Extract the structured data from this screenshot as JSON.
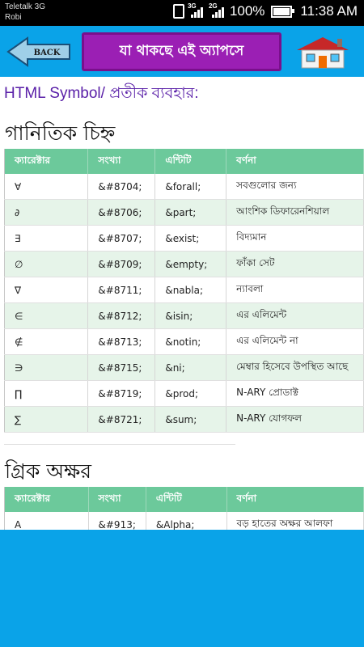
{
  "status_bar": {
    "carrier_line1": "Teletalk 3G",
    "carrier_line2": "Robi",
    "net1": "3G",
    "net2": "2G",
    "battery": "100%",
    "time": "11:38 AM"
  },
  "top_bar": {
    "back_label": "BACK",
    "title": "যা থাকছে এই অ্যাপসে",
    "colors": {
      "bar": "#0aa3e8",
      "title_bg": "#9b1fb4"
    }
  },
  "content": {
    "intro": "HTML Symbol/ প্রতীক ব্যবহার:",
    "sections": [
      {
        "heading": "গানিতিক চিহ্ন",
        "columns": [
          "ক্যারেক্টার",
          "সংখ্যা",
          "এন্টিটি",
          "বর্ণনা"
        ],
        "rows": [
          [
            "∀",
            "&#8704;",
            "&forall;",
            "সবগুলোর জন্য"
          ],
          [
            "∂",
            "&#8706;",
            "&part;",
            "আংশিক ডিফারেনশিয়াল"
          ],
          [
            "∃",
            "&#8707;",
            "&exist;",
            "বিদ্যমান"
          ],
          [
            "∅",
            "&#8709;",
            "&empty;",
            "ফাঁকা সেট"
          ],
          [
            "∇",
            "&#8711;",
            "&nabla;",
            "ন্যাবলা"
          ],
          [
            "∈",
            "&#8712;",
            "&isin;",
            "এর এলিমেন্ট"
          ],
          [
            "∉",
            "&#8713;",
            "&notin;",
            "এর এলিমেন্ট না"
          ],
          [
            "∋",
            "&#8715;",
            "&ni;",
            "মেম্বার হিসেবে উপস্থিত আছে"
          ],
          [
            "∏",
            "&#8719;",
            "&prod;",
            "N-ARY প্রোডাক্ট"
          ],
          [
            "∑",
            "&#8721;",
            "&sum;",
            "N-ARY যোগফল"
          ]
        ]
      },
      {
        "heading": "গ্রিক অক্ষর",
        "columns": [
          "ক্যারেক্টার",
          "সংখ্যা",
          "এন্টিটি",
          "বর্ণনা"
        ],
        "rows": [
          [
            "A",
            "&#913;",
            "&Alpha;",
            "বড় হাতের অক্ষর আলফা"
          ]
        ]
      }
    ]
  }
}
